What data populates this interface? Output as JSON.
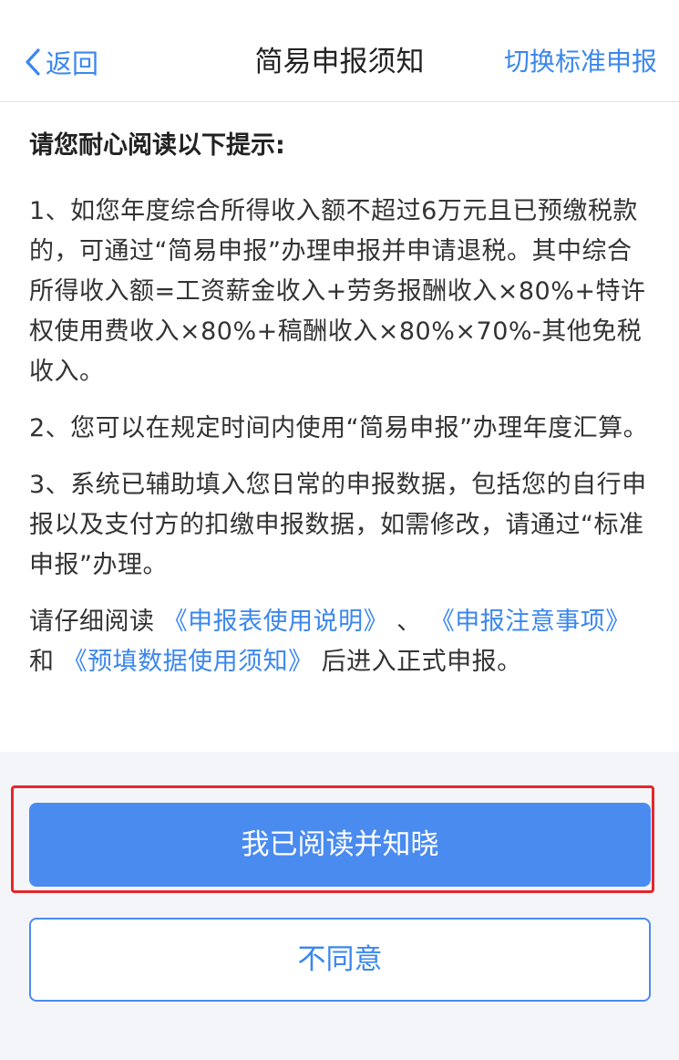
{
  "header": {
    "back_label": "返回",
    "title": "简易申报须知",
    "switch_label": "切换标准申报"
  },
  "content": {
    "intro": "请您耐心阅读以下提示:",
    "item1": "1、如您年度综合所得收入额不超过6万元且已预缴税款的，可通过“简易申报”办理申报并申请退税。其中综合所得收入额=工资薪金收入+劳务报酬收入×80%+特许权使用费收入×80%+稿酬收入×80%×70%-其他免税收入。",
    "item2": "2、您可以在规定时间内使用“简易申报”办理年度汇算。",
    "item3": "3、系统已辅助填入您日常的申报数据，包括您的自行申报以及支付方的扣缴申报数据，如需修改，请通过“标准申报”办理。",
    "notice": {
      "prefix": "请仔细阅读 ",
      "link1": "《申报表使用说明》",
      "sep1": " 、 ",
      "link2": "《申报注意事项》",
      "sep2": " 和 ",
      "link3": "《预填数据使用须知》",
      "suffix": " 后进入正式申报。"
    }
  },
  "footer": {
    "confirm_label": "我已阅读并知晓",
    "decline_label": "不同意"
  },
  "colors": {
    "accent": "#3b87ee",
    "primary_button": "#4a8bf0",
    "highlight_border": "#e5262b"
  },
  "icons": {
    "back": "chevron-left-icon"
  }
}
